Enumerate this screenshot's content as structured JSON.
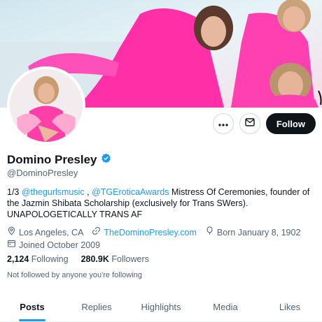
{
  "profile": {
    "name": "Domino Presley",
    "handle": "@DominoPresley",
    "follow_label": "Follow",
    "bio": {
      "prefix": "1/3 ",
      "mention1": "@thegurlsmusic",
      "sep": " , ",
      "mention2": "@TGEroticaAwards",
      "text": " Mistress Of Ceremonies, founder of the Jazmin Shibata Scholarship (exclusively for Trans SWers). UNAPOLOGETICALLY TRANS AF"
    },
    "location": "Los Angeles, CA",
    "website": "TheDominoPresley.com",
    "born": "Born January 8, 1902",
    "joined": "Joined October 2009",
    "following_count": "2,124",
    "following_label": "Following",
    "followers_count": "280.9K",
    "followers_label": "Followers",
    "not_followed": "Not followed by anyone you're following"
  },
  "tabs": [
    {
      "label": "Posts"
    },
    {
      "label": "Replies"
    },
    {
      "label": "Highlights"
    },
    {
      "label": "Media"
    },
    {
      "label": "Likes"
    }
  ],
  "colors": {
    "accent": "#1d9bf0",
    "banner_pink": "#ff2fa8",
    "dark": "#0f1419"
  },
  "icons": [
    "more-icon",
    "message-icon",
    "verified-icon",
    "location-icon",
    "link-icon",
    "balloon-icon",
    "calendar-icon"
  ]
}
